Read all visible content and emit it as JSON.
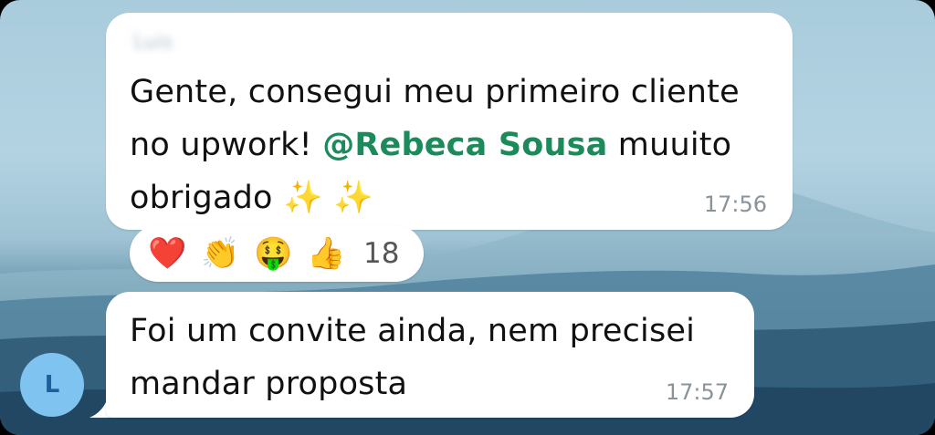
{
  "messages": [
    {
      "sender": "Luis",
      "text_before": "Gente, consegui meu primeiro cliente no upwork! ",
      "mention": "@Rebeca Sousa",
      "text_after": " muuito obrigado ✨ ✨",
      "time": "17:56",
      "reactions": [
        {
          "icon": "red-heart",
          "glyph": "❤️"
        },
        {
          "icon": "clapping-hands",
          "glyph": "👏"
        },
        {
          "icon": "money-mouth-face",
          "glyph": "🤑"
        },
        {
          "icon": "thumbs-up",
          "glyph": "👍"
        }
      ],
      "reaction_count": "18"
    },
    {
      "text": "Foi um convite ainda, nem precisei mandar proposta",
      "time": "17:57"
    }
  ],
  "avatar": {
    "initial": "L",
    "color": "#7fc3f0"
  },
  "colors": {
    "mention": "#1c8a5a",
    "bubble": "#ffffff",
    "time": "#8a9399"
  }
}
